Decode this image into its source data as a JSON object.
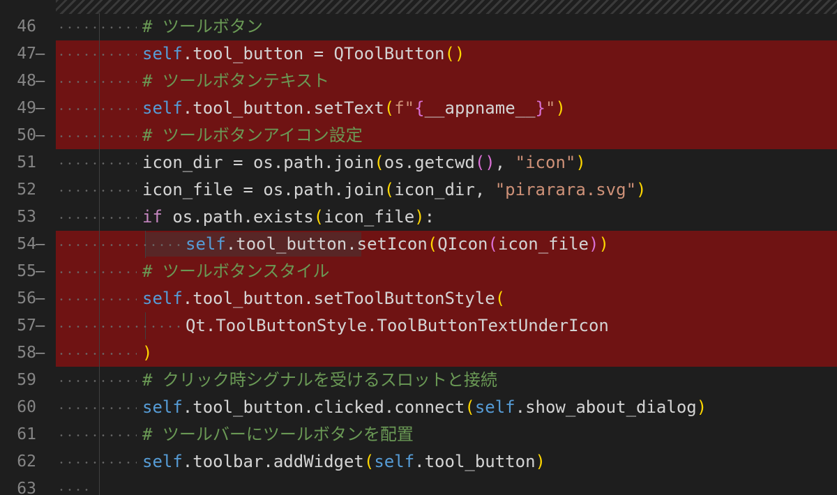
{
  "editor": {
    "colors": {
      "background": "#1e1e1e",
      "deleted_line_bg": "#6f1313",
      "line_number": "#858585",
      "self_keyword": "#569cd6",
      "comment": "#6a9955",
      "string": "#ce9178",
      "control_keyword": "#c586c0",
      "bracket_level1": "#ffd700",
      "bracket_level2": "#da70d6",
      "bracket_level3": "#179fff"
    },
    "lines": [
      {
        "num": "46",
        "marker": "",
        "deleted": false,
        "indent": 2,
        "tokens": [
          {
            "t": "# ツールボタン",
            "c": "com"
          }
        ]
      },
      {
        "num": "47",
        "marker": "—",
        "deleted": true,
        "indent": 2,
        "tokens": [
          {
            "t": "self",
            "c": "self"
          },
          {
            "t": ".tool_button = QToolButton",
            "c": "op"
          },
          {
            "t": "()",
            "c": "b1"
          }
        ]
      },
      {
        "num": "48",
        "marker": "—",
        "deleted": true,
        "indent": 2,
        "tokens": [
          {
            "t": "# ツールボタンテキスト",
            "c": "com"
          }
        ]
      },
      {
        "num": "49",
        "marker": "—",
        "deleted": true,
        "indent": 2,
        "tokens": [
          {
            "t": "self",
            "c": "self"
          },
          {
            "t": ".tool_button.setText",
            "c": "op"
          },
          {
            "t": "(",
            "c": "b1"
          },
          {
            "t": "f\"",
            "c": "str"
          },
          {
            "t": "{",
            "c": "b2"
          },
          {
            "t": "__appname__",
            "c": "op"
          },
          {
            "t": "}",
            "c": "b2"
          },
          {
            "t": "\"",
            "c": "str"
          },
          {
            "t": ")",
            "c": "b1"
          }
        ]
      },
      {
        "num": "50",
        "marker": "—",
        "deleted": true,
        "indent": 2,
        "tokens": [
          {
            "t": "# ツールボタンアイコン設定",
            "c": "com"
          }
        ]
      },
      {
        "num": "51",
        "marker": "",
        "deleted": false,
        "indent": 2,
        "tokens": [
          {
            "t": "icon_dir = os.path.join",
            "c": "op"
          },
          {
            "t": "(",
            "c": "b1"
          },
          {
            "t": "os.getcwd",
            "c": "op"
          },
          {
            "t": "()",
            "c": "b2"
          },
          {
            "t": ", ",
            "c": "op"
          },
          {
            "t": "\"icon\"",
            "c": "str"
          },
          {
            "t": ")",
            "c": "b1"
          }
        ]
      },
      {
        "num": "52",
        "marker": "",
        "deleted": false,
        "indent": 2,
        "tokens": [
          {
            "t": "icon_file = os.path.join",
            "c": "op"
          },
          {
            "t": "(",
            "c": "b1"
          },
          {
            "t": "icon_dir, ",
            "c": "op"
          },
          {
            "t": "\"pirarara.svg\"",
            "c": "str"
          },
          {
            "t": ")",
            "c": "b1"
          }
        ]
      },
      {
        "num": "53",
        "marker": "",
        "deleted": false,
        "indent": 2,
        "tokens": [
          {
            "t": "if",
            "c": "kw"
          },
          {
            "t": " os.path.exists",
            "c": "op"
          },
          {
            "t": "(",
            "c": "b1"
          },
          {
            "t": "icon_file",
            "c": "op"
          },
          {
            "t": ")",
            "c": "b1"
          },
          {
            "t": ":",
            "c": "op"
          }
        ]
      },
      {
        "num": "54",
        "marker": "—",
        "deleted": true,
        "indent": 3,
        "tokens": [
          {
            "t": "self",
            "c": "self"
          },
          {
            "t": ".tool_button.setIcon",
            "c": "op"
          },
          {
            "t": "(",
            "c": "b1"
          },
          {
            "t": "QIcon",
            "c": "op"
          },
          {
            "t": "(",
            "c": "b2"
          },
          {
            "t": "icon_file",
            "c": "op"
          },
          {
            "t": ")",
            "c": "b2"
          },
          {
            "t": ")",
            "c": "b1"
          }
        ]
      },
      {
        "num": "55",
        "marker": "—",
        "deleted": true,
        "indent": 2,
        "tokens": [
          {
            "t": "# ツールボタンスタイル",
            "c": "com"
          }
        ]
      },
      {
        "num": "56",
        "marker": "—",
        "deleted": true,
        "indent": 2,
        "tokens": [
          {
            "t": "self",
            "c": "self"
          },
          {
            "t": ".tool_button.setToolButtonStyle",
            "c": "op"
          },
          {
            "t": "(",
            "c": "b1"
          }
        ]
      },
      {
        "num": "57",
        "marker": "—",
        "deleted": true,
        "indent": 3,
        "tokens": [
          {
            "t": "Qt.ToolButtonStyle.ToolButtonTextUnderIcon",
            "c": "op"
          }
        ]
      },
      {
        "num": "58",
        "marker": "—",
        "deleted": true,
        "indent": 2,
        "tokens": [
          {
            "t": ")",
            "c": "b1"
          }
        ]
      },
      {
        "num": "59",
        "marker": "",
        "deleted": false,
        "indent": 2,
        "tokens": [
          {
            "t": "# クリック時シグナルを受けるスロットと接続",
            "c": "com"
          }
        ]
      },
      {
        "num": "60",
        "marker": "",
        "deleted": false,
        "indent": 2,
        "tokens": [
          {
            "t": "self",
            "c": "self"
          },
          {
            "t": ".tool_button.clicked.connect",
            "c": "op"
          },
          {
            "t": "(",
            "c": "b1"
          },
          {
            "t": "self",
            "c": "self"
          },
          {
            "t": ".show_about_dialog",
            "c": "op"
          },
          {
            "t": ")",
            "c": "b1"
          }
        ]
      },
      {
        "num": "61",
        "marker": "",
        "deleted": false,
        "indent": 2,
        "tokens": [
          {
            "t": "# ツールバーにツールボタンを配置",
            "c": "com"
          }
        ]
      },
      {
        "num": "62",
        "marker": "",
        "deleted": false,
        "indent": 2,
        "tokens": [
          {
            "t": "self",
            "c": "self"
          },
          {
            "t": ".toolbar.addWidget",
            "c": "op"
          },
          {
            "t": "(",
            "c": "b1"
          },
          {
            "t": "self",
            "c": "self"
          },
          {
            "t": ".tool_button",
            "c": "op"
          },
          {
            "t": ")",
            "c": "b1"
          }
        ]
      },
      {
        "num": "63",
        "marker": "",
        "deleted": false,
        "indent": 0,
        "tokens": []
      }
    ]
  }
}
